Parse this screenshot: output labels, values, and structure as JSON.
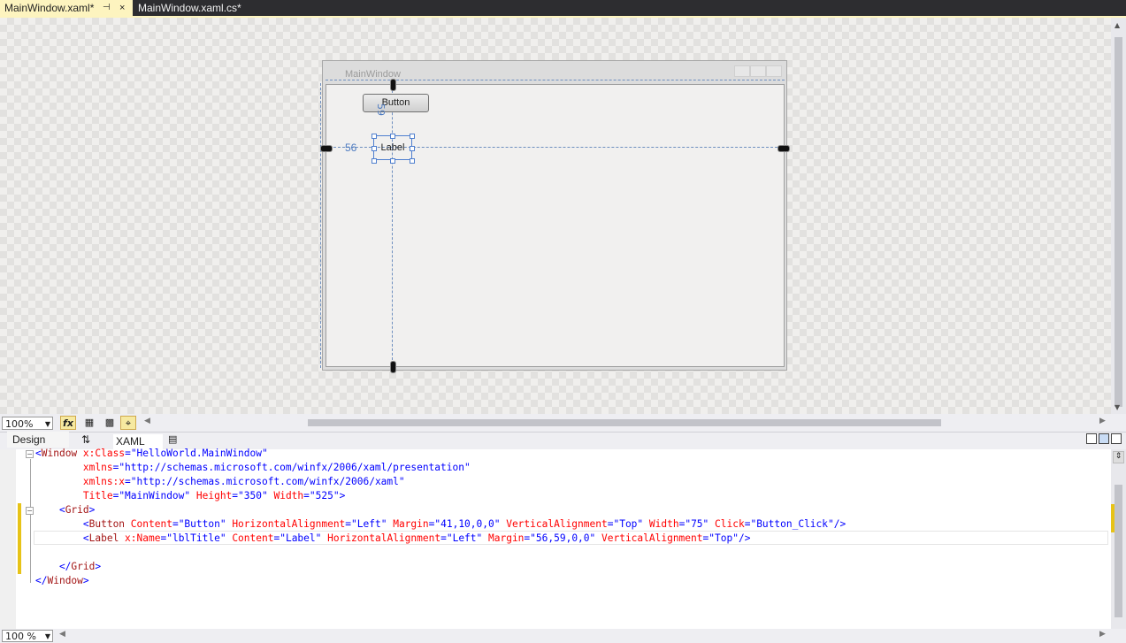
{
  "tabs": [
    {
      "label": "MainWindow.xaml*",
      "pin": "⊣",
      "close": "×"
    },
    {
      "label": "MainWindow.xaml.cs*"
    }
  ],
  "designer": {
    "window_title": "MainWindow",
    "button_content": "Button",
    "label_content": "Label",
    "margin_top": "59",
    "margin_left": "56"
  },
  "design_toolbar": {
    "zoom": "100%",
    "fx_label": "fx"
  },
  "view_tabs": {
    "design": "Design",
    "swap": "⇅",
    "xaml": "XAML"
  },
  "code_lines": [
    [
      {
        "c": "p",
        "t": "<"
      },
      {
        "c": "t",
        "t": "Window"
      },
      {
        "c": "a",
        "t": " x:Class"
      },
      {
        "c": "p",
        "t": "="
      },
      {
        "c": "v",
        "t": "\"HelloWorld.MainWindow\""
      }
    ],
    [
      {
        "c": "a",
        "t": "        xmlns"
      },
      {
        "c": "p",
        "t": "="
      },
      {
        "c": "v",
        "t": "\"http://schemas.microsoft.com/winfx/2006/xaml/presentation\""
      }
    ],
    [
      {
        "c": "a",
        "t": "        xmlns:x"
      },
      {
        "c": "p",
        "t": "="
      },
      {
        "c": "v",
        "t": "\"http://schemas.microsoft.com/winfx/2006/xaml\""
      }
    ],
    [
      {
        "c": "a",
        "t": "        Title"
      },
      {
        "c": "p",
        "t": "="
      },
      {
        "c": "v",
        "t": "\"MainWindow\""
      },
      {
        "c": "a",
        "t": " Height"
      },
      {
        "c": "p",
        "t": "="
      },
      {
        "c": "v",
        "t": "\"350\""
      },
      {
        "c": "a",
        "t": " Width"
      },
      {
        "c": "p",
        "t": "="
      },
      {
        "c": "v",
        "t": "\"525\""
      },
      {
        "c": "p",
        "t": ">"
      }
    ],
    [
      {
        "c": "p",
        "t": "    <"
      },
      {
        "c": "t",
        "t": "Grid"
      },
      {
        "c": "p",
        "t": ">"
      }
    ],
    [
      {
        "c": "p",
        "t": "        <"
      },
      {
        "c": "t",
        "t": "Button"
      },
      {
        "c": "a",
        "t": " Content"
      },
      {
        "c": "p",
        "t": "="
      },
      {
        "c": "v",
        "t": "\"Button\""
      },
      {
        "c": "a",
        "t": " HorizontalAlignment"
      },
      {
        "c": "p",
        "t": "="
      },
      {
        "c": "v",
        "t": "\"Left\""
      },
      {
        "c": "a",
        "t": " Margin"
      },
      {
        "c": "p",
        "t": "="
      },
      {
        "c": "v",
        "t": "\"41,10,0,0\""
      },
      {
        "c": "a",
        "t": " VerticalAlignment"
      },
      {
        "c": "p",
        "t": "="
      },
      {
        "c": "v",
        "t": "\"Top\""
      },
      {
        "c": "a",
        "t": " Width"
      },
      {
        "c": "p",
        "t": "="
      },
      {
        "c": "v",
        "t": "\"75\""
      },
      {
        "c": "a",
        "t": " Click"
      },
      {
        "c": "p",
        "t": "="
      },
      {
        "c": "v",
        "t": "\"Button_Click\""
      },
      {
        "c": "p",
        "t": "/>"
      }
    ],
    [
      {
        "c": "p",
        "t": "        <"
      },
      {
        "c": "t",
        "t": "Label"
      },
      {
        "c": "a",
        "t": " x:Name"
      },
      {
        "c": "p",
        "t": "="
      },
      {
        "c": "v",
        "t": "\"lblTitle\""
      },
      {
        "c": "a",
        "t": " Content"
      },
      {
        "c": "p",
        "t": "="
      },
      {
        "c": "v",
        "t": "\"Label\""
      },
      {
        "c": "a",
        "t": " HorizontalAlignment"
      },
      {
        "c": "p",
        "t": "="
      },
      {
        "c": "v",
        "t": "\"Left\""
      },
      {
        "c": "a",
        "t": " Margin"
      },
      {
        "c": "p",
        "t": "="
      },
      {
        "c": "v",
        "t": "\"56,59,0,0\""
      },
      {
        "c": "a",
        "t": " VerticalAlignment"
      },
      {
        "c": "p",
        "t": "="
      },
      {
        "c": "v",
        "t": "\"Top\""
      },
      {
        "c": "p",
        "t": "/>"
      }
    ],
    [],
    [
      {
        "c": "p",
        "t": "    </"
      },
      {
        "c": "t",
        "t": "Grid"
      },
      {
        "c": "p",
        "t": ">"
      }
    ],
    [
      {
        "c": "p",
        "t": "</"
      },
      {
        "c": "t",
        "t": "Window"
      },
      {
        "c": "p",
        "t": ">"
      }
    ]
  ],
  "bottom": {
    "zoom": "100 %"
  },
  "colors": {
    "tab_active": "#fdf4bf",
    "accent": "#e7c317",
    "guide": "#6e8fbf"
  }
}
